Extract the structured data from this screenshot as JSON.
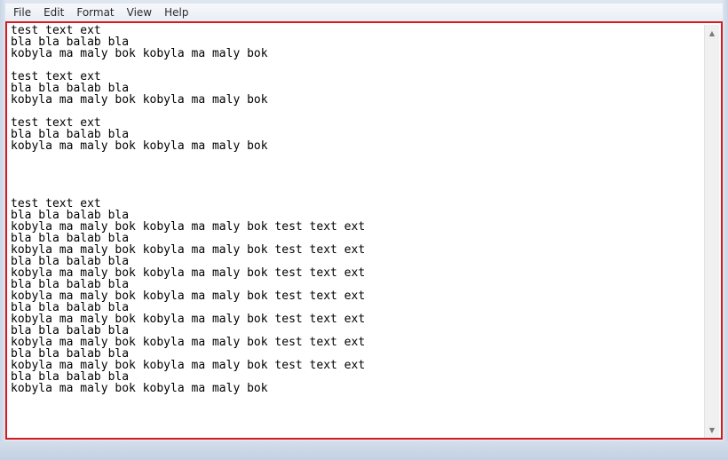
{
  "menu": {
    "items": [
      "File",
      "Edit",
      "Format",
      "View",
      "Help"
    ]
  },
  "editor": {
    "lines": [
      "test text ext",
      "bla bla balab bla",
      "kobyla ma maly bok kobyla ma maly bok",
      "",
      "test text ext",
      "bla bla balab bla",
      "kobyla ma maly bok kobyla ma maly bok",
      "",
      "test text ext",
      "bla bla balab bla",
      "kobyla ma maly bok kobyla ma maly bok",
      "",
      "",
      "",
      "",
      "test text ext",
      "bla bla balab bla",
      "kobyla ma maly bok kobyla ma maly bok test text ext",
      "bla bla balab bla",
      "kobyla ma maly bok kobyla ma maly bok test text ext",
      "bla bla balab bla",
      "kobyla ma maly bok kobyla ma maly bok test text ext",
      "bla bla balab bla",
      "kobyla ma maly bok kobyla ma maly bok test text ext",
      "bla bla balab bla",
      "kobyla ma maly bok kobyla ma maly bok test text ext",
      "bla bla balab bla",
      "kobyla ma maly bok kobyla ma maly bok test text ext",
      "bla bla balab bla",
      "kobyla ma maly bok kobyla ma maly bok test text ext",
      "bla bla balab bla",
      "kobyla ma maly bok kobyla ma maly bok"
    ]
  },
  "scrollbar": {
    "up_icon": "arrow-up-icon",
    "down_icon": "arrow-down-icon",
    "up_glyph": "▲",
    "down_glyph": "▼"
  },
  "colors": {
    "highlight_border": "#d71920"
  }
}
